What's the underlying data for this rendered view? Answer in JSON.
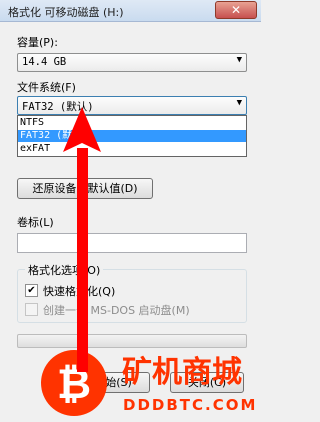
{
  "window": {
    "title": "格式化 可移动磁盘 (H:)",
    "close_glyph": "✕"
  },
  "capacity": {
    "label": "容量(P):",
    "value": "14.4 GB"
  },
  "filesystem": {
    "label": "文件系统(F)",
    "value": "FAT32 (默认)",
    "options": [
      {
        "label": "NTFS",
        "selected": false
      },
      {
        "label": "FAT32 (默认)",
        "selected": true
      },
      {
        "label": "exFAT",
        "selected": false
      }
    ]
  },
  "restore_button": "还原设备的默认值(D)",
  "volume_label": {
    "label": "卷标(L)",
    "value": ""
  },
  "format_options": {
    "title": "格式化选项(O)",
    "quick_format": {
      "label": "快速格式化(Q)",
      "checked": true
    },
    "msdos_boot": {
      "label": "创建一个 MS-DOS 启动盘(M)",
      "checked": false,
      "disabled": true
    }
  },
  "progress": 0,
  "buttons": {
    "start": "开始(S)",
    "close": "关闭(C)"
  },
  "watermark": {
    "main": "矿机商城",
    "sub": "DDDBTC.COM"
  },
  "colors": {
    "selection": "#3399ff",
    "arrow": "#ff0000",
    "watermark": "#ff3300"
  }
}
